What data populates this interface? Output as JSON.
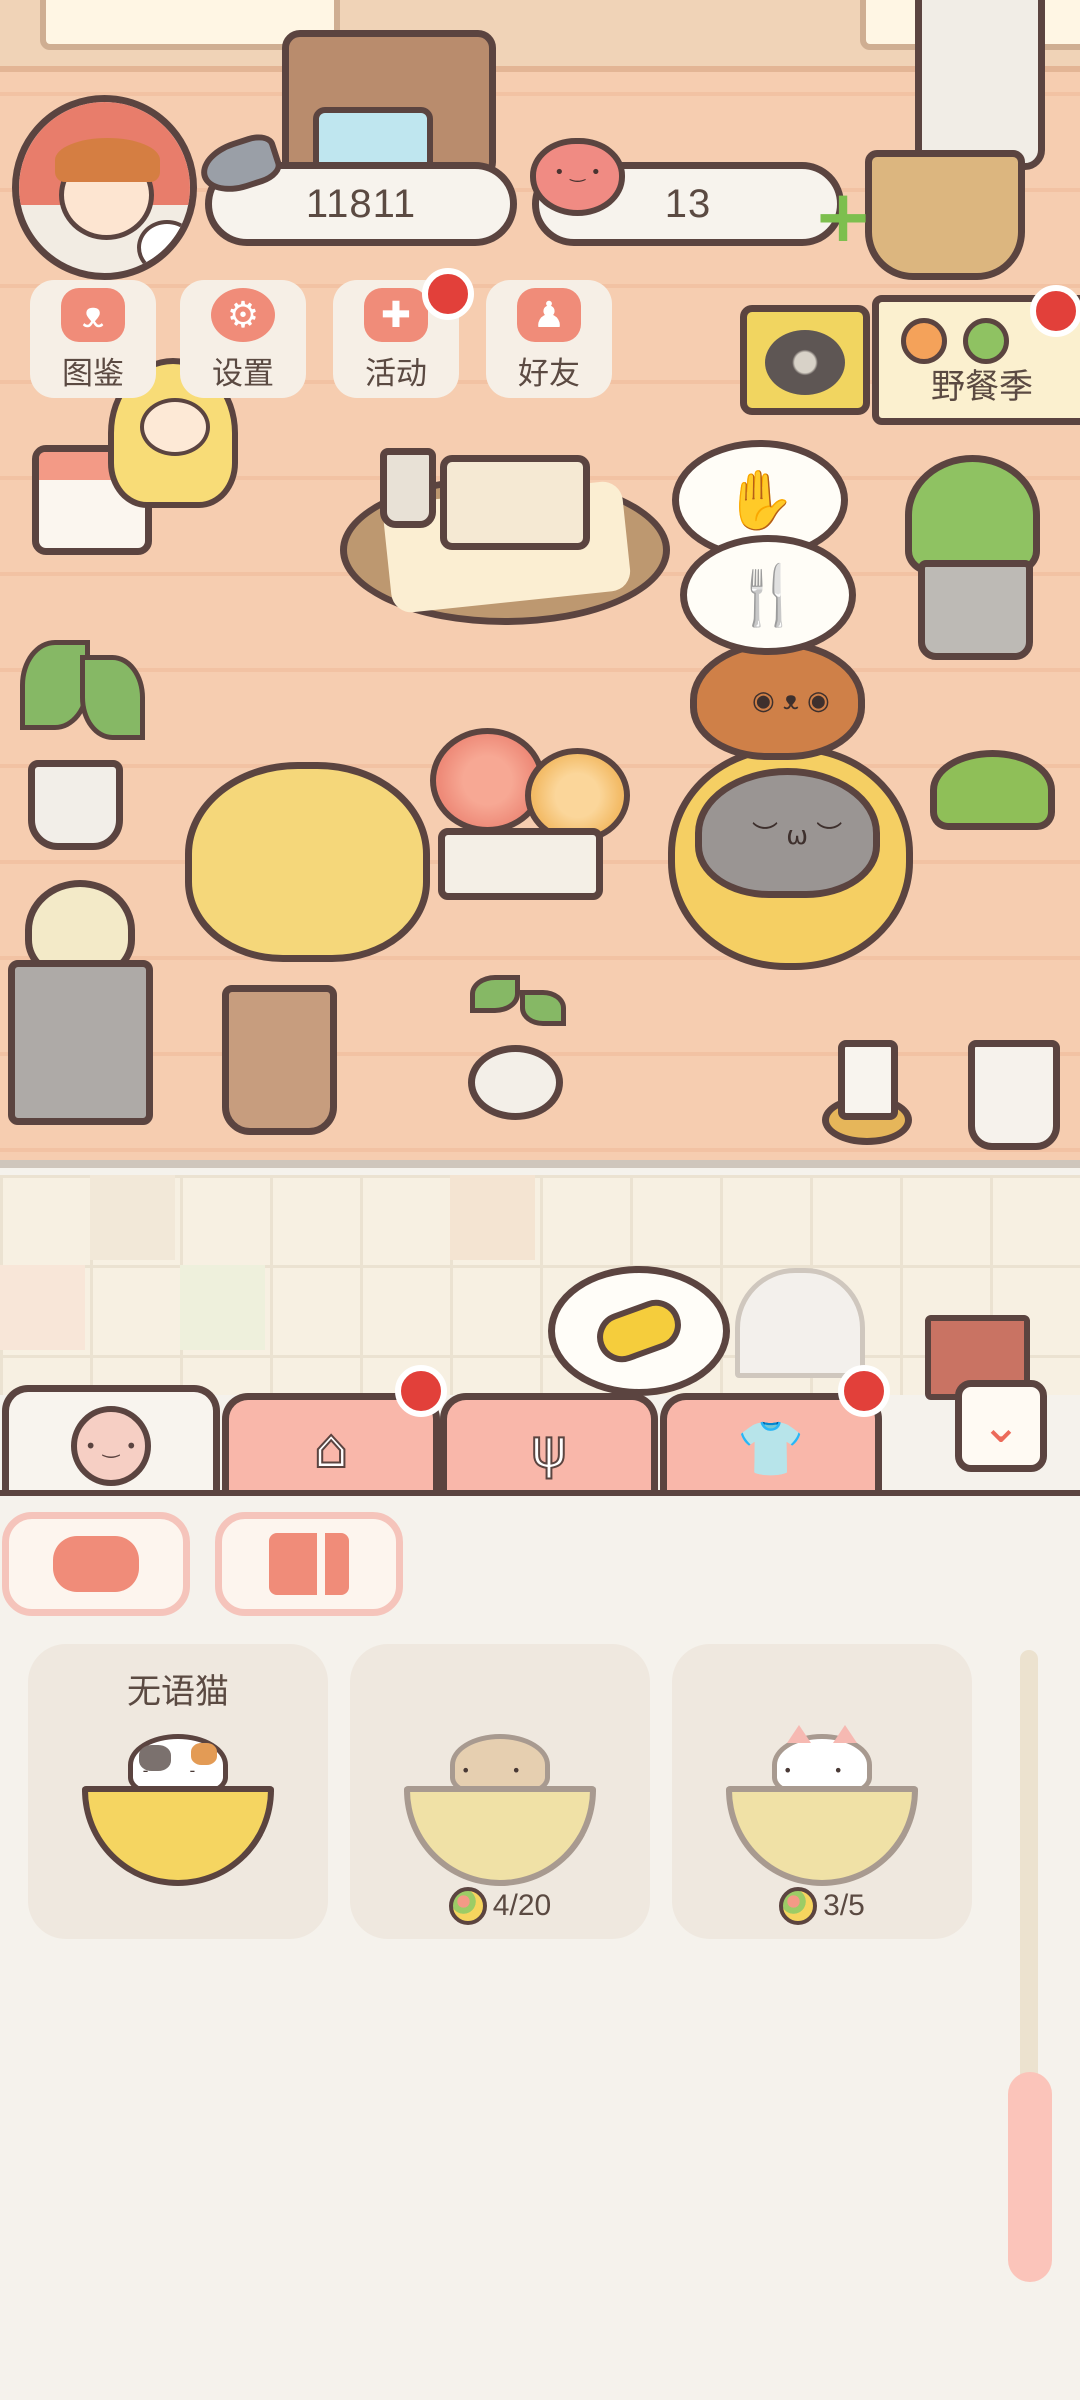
{
  "hud": {
    "fish_coins": "11811",
    "hearts": "13"
  },
  "menu": [
    {
      "label": "图鉴",
      "icon": "cat-face-icon",
      "badge": false
    },
    {
      "label": "设置",
      "icon": "gear-icon",
      "badge": false
    },
    {
      "label": "活动",
      "icon": "gift-icon",
      "badge": true
    },
    {
      "label": "好友",
      "icon": "friends-icon",
      "badge": false
    }
  ],
  "event": {
    "label": "野餐季",
    "badge": true
  },
  "scene_bubbles": [
    {
      "icon": "hand-icon",
      "glyph": "✋"
    },
    {
      "icon": "fork-knife-icon",
      "glyph": "🍴"
    }
  ],
  "tabs": [
    {
      "name": "cat-bowl-tab",
      "icon": "bowl-face-icon",
      "glyph": "• ‿ •",
      "active": true,
      "badge": false
    },
    {
      "name": "home-tab",
      "icon": "house-icon",
      "glyph": "⌂",
      "active": false,
      "badge": true
    },
    {
      "name": "food-tab",
      "icon": "fork-knife-icon",
      "glyph": "ψ",
      "active": false,
      "badge": false
    },
    {
      "name": "clothes-tab",
      "icon": "shirt-icon",
      "glyph": "👕",
      "active": false,
      "badge": true
    }
  ],
  "filters": [
    {
      "icon": "cat-face-icon"
    },
    {
      "icon": "book-icon"
    }
  ],
  "cards": [
    {
      "title": "无语猫",
      "progress": "",
      "style": "spotted",
      "unlocked": true
    },
    {
      "title": "",
      "progress": "4/20",
      "style": "tabby",
      "unlocked": false
    },
    {
      "title": "",
      "progress": "3/5",
      "style": "pinkear",
      "unlocked": false
    }
  ],
  "colors": {
    "accent_coral": "#f08c79",
    "tab_pink": "#f9b7aa",
    "outline_brown": "#5b4440",
    "badge_red": "#e2403a",
    "bowl_yellow": "#f5d561"
  }
}
